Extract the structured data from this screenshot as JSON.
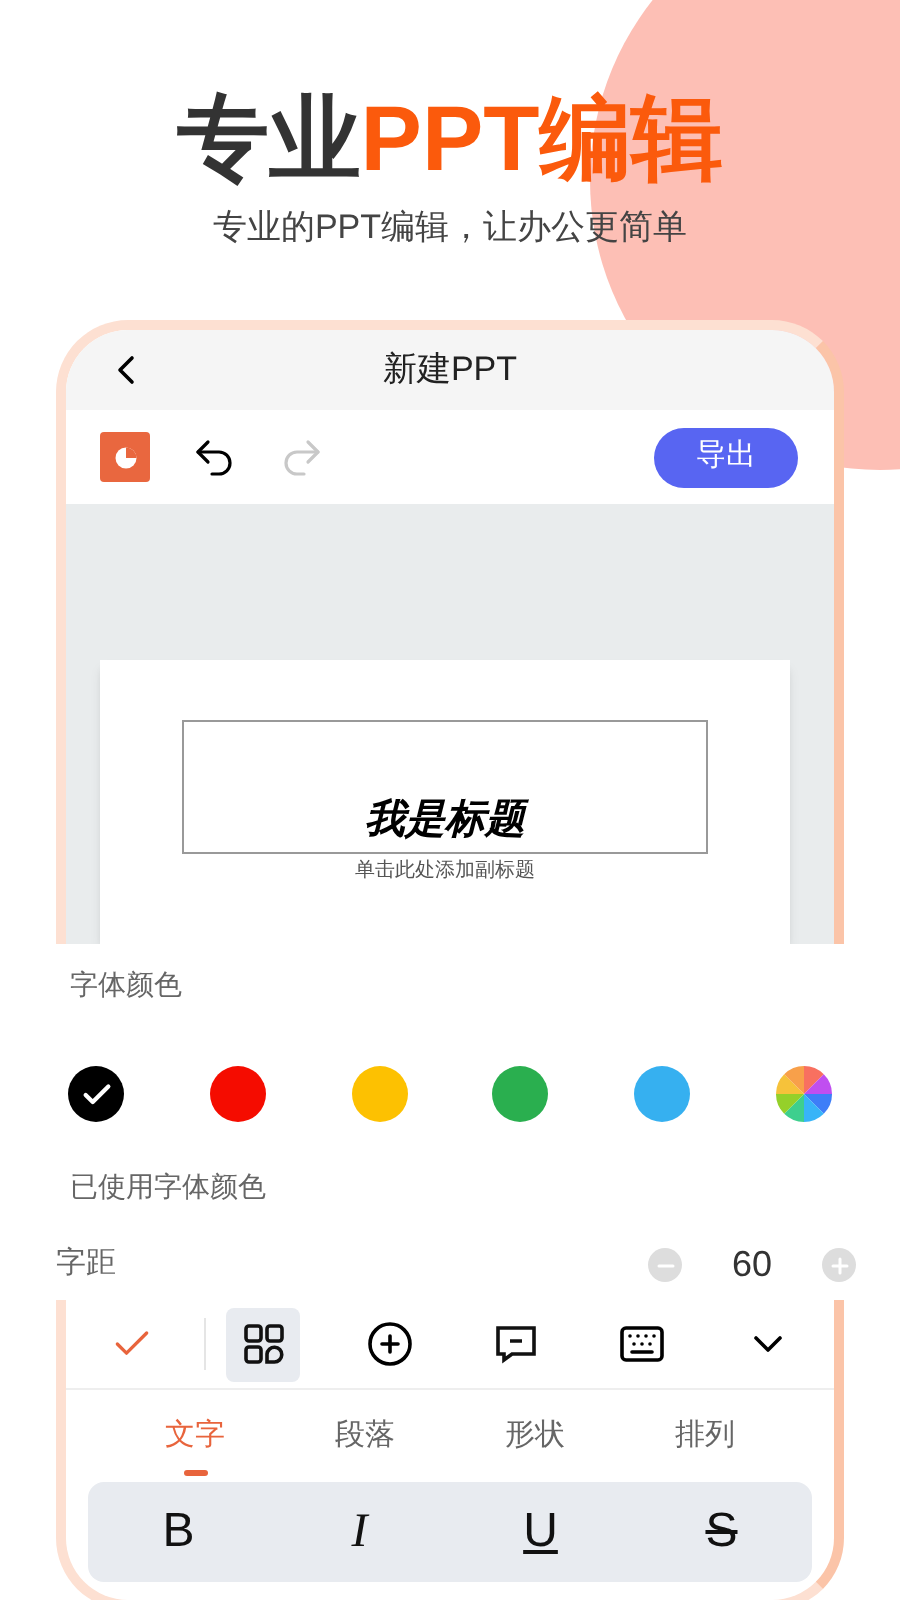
{
  "headline": {
    "dark": "专业",
    "accent": "PPT编辑"
  },
  "subtitle": "专业的PPT编辑，让办公更简单",
  "app": {
    "title": "新建PPT",
    "export_button": "导出",
    "slide": {
      "title": "我是标题",
      "subtitle": "单击此处添加副标题"
    }
  },
  "font_panel": {
    "color_label": "字体颜色",
    "colors": [
      {
        "kind": "swatch",
        "color": "#000000",
        "selected": true
      },
      {
        "kind": "swatch",
        "color": "#f50c00",
        "selected": false
      },
      {
        "kind": "swatch",
        "color": "#fdc101",
        "selected": false
      },
      {
        "kind": "swatch",
        "color": "#2aaf4f",
        "selected": false
      },
      {
        "kind": "swatch",
        "color": "#36b0f0",
        "selected": false
      },
      {
        "kind": "palette",
        "selected": false
      }
    ],
    "used_label": "已使用字体颜色",
    "spacing": {
      "label": "字距",
      "value": "60"
    }
  },
  "toolbar": [
    {
      "kind": "check",
      "selected": false
    },
    {
      "kind": "grid",
      "selected": true
    },
    {
      "kind": "add",
      "selected": false
    },
    {
      "kind": "comment",
      "selected": false
    },
    {
      "kind": "keyboard",
      "selected": false
    },
    {
      "kind": "collapse",
      "selected": false
    }
  ],
  "tabs": [
    {
      "label": "文字",
      "selected": true
    },
    {
      "label": "段落",
      "selected": false
    },
    {
      "label": "形状",
      "selected": false
    },
    {
      "label": "排列",
      "selected": false
    }
  ],
  "format_buttons": [
    {
      "label": "B",
      "kind": "bold"
    },
    {
      "label": "I",
      "kind": "italic"
    },
    {
      "label": "U",
      "kind": "underline"
    },
    {
      "label": "S",
      "kind": "strike"
    }
  ]
}
